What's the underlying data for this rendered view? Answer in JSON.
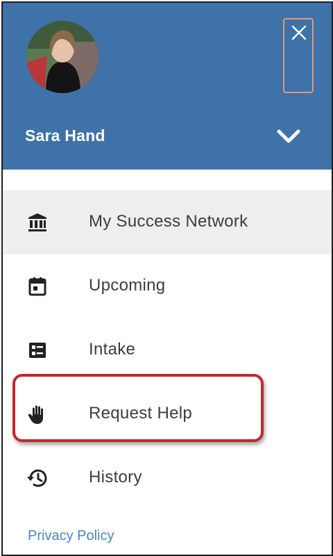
{
  "profile": {
    "name": "Sara Hand",
    "avatar_icon": "user-photo",
    "close_icon": "close-icon",
    "expand_icon": "chevron-down-icon"
  },
  "menu": {
    "items": [
      {
        "label": "My Success Network",
        "icon": "institution-icon",
        "active": true
      },
      {
        "label": "Upcoming",
        "icon": "calendar-icon",
        "active": false
      },
      {
        "label": "Intake",
        "icon": "form-icon",
        "active": false
      },
      {
        "label": "Request Help",
        "icon": "raised-hand-icon",
        "active": false,
        "highlighted": true
      },
      {
        "label": "History",
        "icon": "history-icon",
        "active": false
      }
    ]
  },
  "footer": {
    "privacy_label": "Privacy Policy"
  },
  "colors": {
    "header_bg": "#3e72a9",
    "active_row_bg": "#eeeeee",
    "highlight_border": "#c0282d",
    "close_button_border": "#e39a76",
    "link": "#4a86c5"
  }
}
